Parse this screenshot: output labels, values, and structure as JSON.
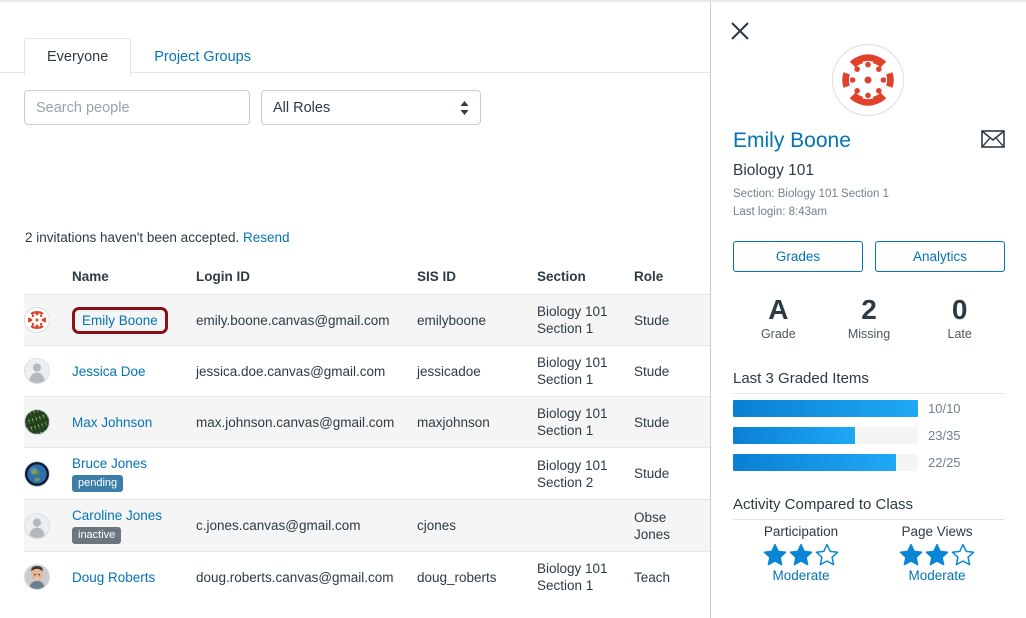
{
  "tabs": [
    {
      "label": "Everyone",
      "active": true
    },
    {
      "label": "Project Groups",
      "active": false
    }
  ],
  "filters": {
    "search_placeholder": "Search people",
    "search_value": "",
    "role_selected": "All Roles"
  },
  "notice": {
    "text": "2 invitations haven't been accepted.",
    "link_label": "Resend"
  },
  "table": {
    "columns": [
      "Name",
      "Login ID",
      "SIS ID",
      "Section",
      "Role"
    ],
    "rows": [
      {
        "avatar": "canvas-logo-avatar",
        "name": "Emily Boone",
        "highlighted": true,
        "badge": "",
        "login_id": "emily.boone.canvas@gmail.com",
        "sis_id": "emilyboone",
        "section": "Biology 101 Section 1",
        "role": "Stude"
      },
      {
        "avatar": "default-user-avatar",
        "name": "Jessica Doe",
        "highlighted": false,
        "badge": "",
        "login_id": "jessica.doe.canvas@gmail.com",
        "sis_id": "jessicadoe",
        "section": "Biology 101 Section 1",
        "role": "Stude"
      },
      {
        "avatar": "crowd-photo-avatar",
        "name": "Max Johnson",
        "highlighted": false,
        "badge": "",
        "login_id": "max.johnson.canvas@gmail.com",
        "sis_id": "maxjohnson",
        "section": "Biology 101 Section 1",
        "role": "Stude"
      },
      {
        "avatar": "earth-photo-avatar",
        "name": "Bruce Jones",
        "highlighted": false,
        "badge": "pending",
        "login_id": "",
        "sis_id": "",
        "section": "Biology 101 Section 2",
        "role": "Stude"
      },
      {
        "avatar": "default-user-avatar",
        "name": "Caroline Jones",
        "highlighted": false,
        "badge": "inactive",
        "login_id": "c.jones.canvas@gmail.com",
        "sis_id": "cjones",
        "section": "",
        "role": "Obse\nJones"
      },
      {
        "avatar": "person-photo-avatar",
        "name": "Doug Roberts",
        "highlighted": false,
        "badge": "",
        "login_id": "doug.roberts.canvas@gmail.com",
        "sis_id": "doug_roberts",
        "section": "Biology 101 Section 1",
        "role": "Teach"
      }
    ]
  },
  "panel": {
    "close_icon": "close-icon",
    "avatar_icon": "canvas-logo-avatar",
    "name": "Emily Boone",
    "mail_icon": "envelope-icon",
    "course": "Biology 101",
    "section_line": "Section: Biology 101 Section 1",
    "last_login_line": "Last login: 8:43am",
    "buttons": [
      {
        "label": "Grades"
      },
      {
        "label": "Analytics"
      }
    ],
    "stats": [
      {
        "value": "A",
        "label": "Grade"
      },
      {
        "value": "2",
        "label": "Missing"
      },
      {
        "value": "0",
        "label": "Late"
      }
    ],
    "graded_title": "Last 3 Graded Items",
    "graded_items": [
      {
        "label": "10/10",
        "score": 10,
        "possible": 10,
        "percent": 100
      },
      {
        "label": "23/35",
        "score": 23,
        "possible": 35,
        "percent": 66
      },
      {
        "label": "22/25",
        "score": 22,
        "possible": 25,
        "percent": 88
      }
    ],
    "activity_title": "Activity Compared to Class",
    "activity": [
      {
        "title": "Participation",
        "stars_filled": 2,
        "stars_total": 3,
        "level": "Moderate"
      },
      {
        "title": "Page Views",
        "stars_filled": 2,
        "stars_total": 3,
        "level": "Moderate"
      }
    ]
  },
  "colors": {
    "link": "#0374b5",
    "text": "#2d3b45",
    "muted": "#73818c",
    "border": "#e3e6e8",
    "highlight_outline": "#8a0f16",
    "bar_fill": "#1fa8f5",
    "badge_pending": "#3b7ea8",
    "badge_inactive": "#6b7780",
    "canvas_red": "#e0412b"
  }
}
